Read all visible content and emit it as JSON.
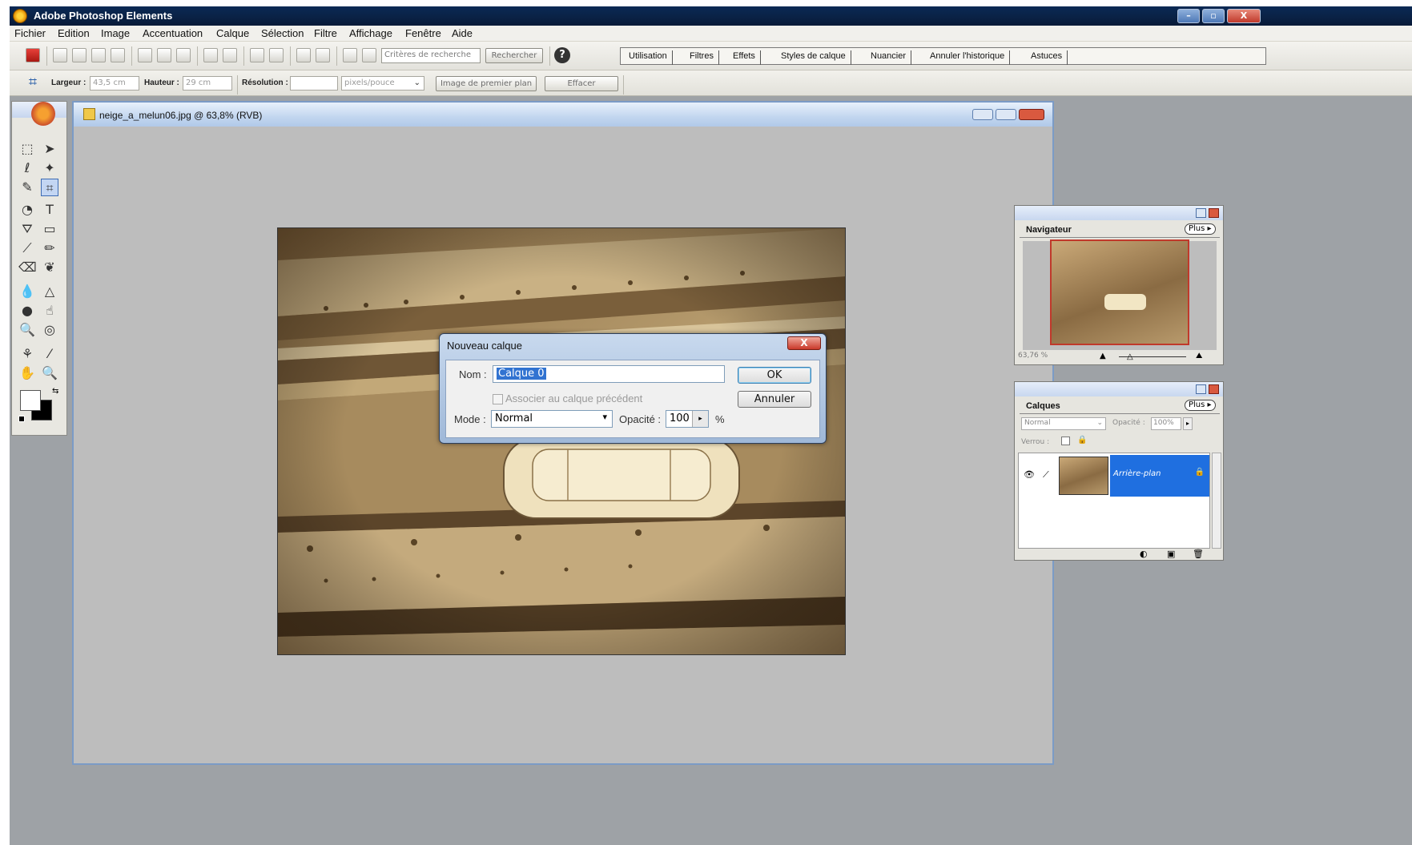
{
  "window": {
    "title": "Adobe Photoshop Elements",
    "buttons": [
      "–",
      "▫",
      "X"
    ]
  },
  "menubar": [
    "Fichier",
    "Edition",
    "Image",
    "Accentuation",
    "Calque",
    "Sélection",
    "Filtre",
    "Affichage",
    "Fenêtre",
    "Aide"
  ],
  "toolbar": {
    "search_placeholder": "Critères de recherche",
    "search_button": "Rechercher",
    "help": "?",
    "palette_tabs": [
      "Utilisation",
      "Filtres",
      "Effets",
      "Styles de calque",
      "Nuancier",
      "Annuler l'historique",
      "Astuces"
    ]
  },
  "options": {
    "width_label": "Largeur :",
    "width_value": "43,5 cm",
    "height_label": "Hauteur :",
    "height_value": "29 cm",
    "resolution_label": "Résolution :",
    "resolution_value": "",
    "units_value": "pixels/pouce",
    "front_image_button": "Image de premier plan",
    "clear_button": "Effacer"
  },
  "document": {
    "title": "neige_a_melun06.jpg @ 63,8% (RVB)"
  },
  "dialog": {
    "title": "Nouveau calque",
    "close": "X",
    "name_label": "Nom :",
    "name_value": "Calque 0",
    "ok_button": "OK",
    "cancel_button": "Annuler",
    "clipping_label": "Associer au calque précédent",
    "mode_label": "Mode :",
    "mode_value": "Normal",
    "opacity_label": "Opacité :",
    "opacity_value": "100",
    "opacity_unit": "%"
  },
  "navigator": {
    "tab": "Navigateur",
    "more": "Plus ▸",
    "zoom": "63,76 %"
  },
  "layers": {
    "tab": "Calques",
    "more": "Plus ▸",
    "blend_mode": "Normal",
    "opacity_label": "Opacité :",
    "opacity_value": "100%",
    "lock_label": "Verrou :",
    "layer_name": "Arrière-plan"
  },
  "colors": {
    "title_bar": "#0a2144",
    "workspace": "#9ea2a6",
    "layer_selected": "#1f6fe0",
    "photo_tone": "#a58a5c"
  }
}
